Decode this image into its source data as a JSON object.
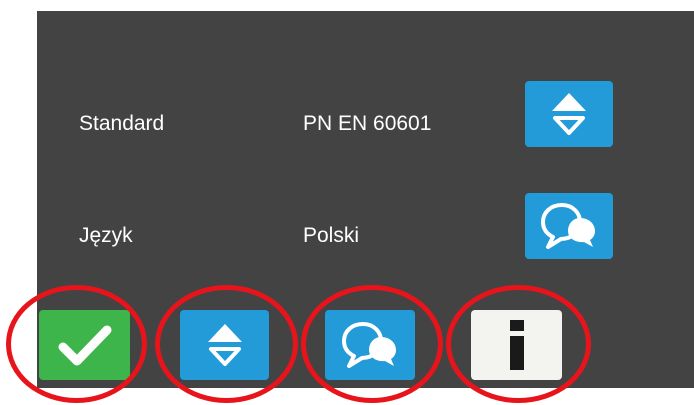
{
  "settings": {
    "rows": [
      {
        "label": "Standard",
        "value": "PN EN 60601",
        "action_icon": "up-down-arrows-icon"
      },
      {
        "label": "Język",
        "value": "Polski",
        "action_icon": "speech-bubbles-icon"
      }
    ]
  },
  "toolbar": {
    "buttons": [
      {
        "icon": "checkmark-icon",
        "color": "#3db54a"
      },
      {
        "icon": "up-down-arrows-icon",
        "color": "#239bd9"
      },
      {
        "icon": "speech-bubbles-icon",
        "color": "#239bd9"
      },
      {
        "icon": "info-icon",
        "color": "#f3f3ef"
      }
    ]
  },
  "highlight_color": "#e8141b",
  "panel_color": "#434343"
}
